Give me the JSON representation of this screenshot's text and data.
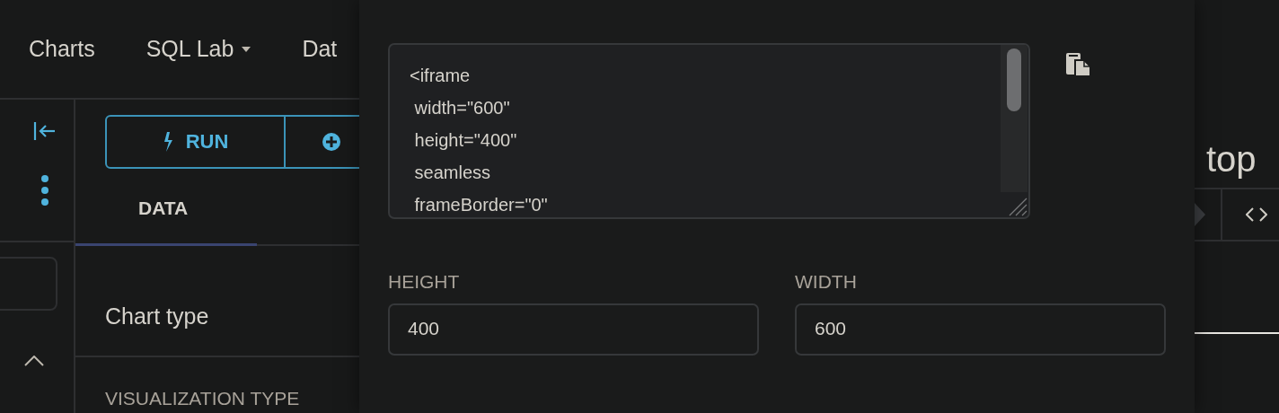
{
  "nav": {
    "items": [
      {
        "label": "Charts",
        "dropdown": false
      },
      {
        "label": "SQL Lab",
        "dropdown": true
      },
      {
        "label": "Dat",
        "dropdown": false
      }
    ]
  },
  "toolbar": {
    "run_label": "RUN"
  },
  "tabs": [
    {
      "label": "DATA",
      "selected": true
    }
  ],
  "section": {
    "title": "Chart type",
    "control_label": "VISUALIZATION TYPE"
  },
  "embed": {
    "code_lines": [
      "<iframe",
      " width=\"600\"",
      " height=\"400\"",
      " seamless",
      " frameBorder=\"0\""
    ],
    "fields": [
      {
        "label": "HEIGHT",
        "value": "400"
      },
      {
        "label": "WIDTH",
        "value": "600"
      }
    ]
  },
  "right_panel": {
    "title": "top"
  }
}
